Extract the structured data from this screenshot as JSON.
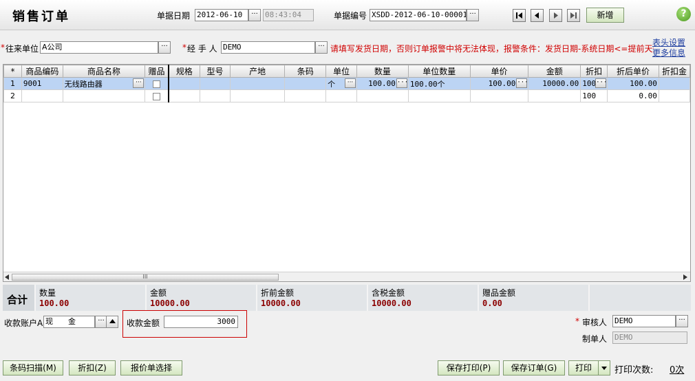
{
  "header": {
    "title": "销售订单",
    "date_label": "单据日期",
    "date_value": "2012-06-10",
    "time_value": "08:43:04",
    "docno_label": "单据编号",
    "docno_value": "XSDD-2012-06-10-00001",
    "new_button": "新增",
    "help": "?"
  },
  "party": {
    "req_mark": "*",
    "customer_label": "往来单位",
    "customer_value": "A公司",
    "handler_label": "经 手 人",
    "handler_value": "DEMO",
    "warning": "请填写发货日期，否则订单报警中将无法体现，报警条件：发货日期-系统日期<=提前天数",
    "header_settings_link": "表头设置",
    "more_info_link": "更多信息"
  },
  "grid": {
    "columns": [
      "*",
      "商品编码",
      "商品名称",
      "赠品",
      "规格",
      "型号",
      "产地",
      "条码",
      "单位",
      "数量",
      "单位数量",
      "单价",
      "金额",
      "折扣",
      "折后单价",
      "折扣金"
    ],
    "rows": [
      {
        "no": "1",
        "code": "9001",
        "name": "无线路由器",
        "spec": "",
        "model": "",
        "origin": "",
        "barcode": "",
        "unit": "个",
        "qty": "100.00",
        "unit_qty": "100.00个",
        "price": "100.00",
        "amount": "10000.00",
        "discount": "100",
        "disc_price": "100.00",
        "disc_amount": ""
      },
      {
        "no": "2",
        "code": "",
        "name": "",
        "spec": "",
        "model": "",
        "origin": "",
        "barcode": "",
        "unit": "",
        "qty": "",
        "unit_qty": "",
        "price": "",
        "amount": "",
        "discount": "100",
        "disc_price": "0.00",
        "disc_amount": ""
      }
    ],
    "scroll_grip": "III"
  },
  "summary": {
    "total_label": "合计",
    "items": [
      {
        "label": "数量",
        "value": "100.00"
      },
      {
        "label": "金额",
        "value": "10000.00"
      },
      {
        "label": "折前金额",
        "value": "10000.00"
      },
      {
        "label": "含税金额",
        "value": "10000.00"
      },
      {
        "label": "赠品金额",
        "value": "0.00"
      }
    ]
  },
  "payment": {
    "account_label": "收款账户A",
    "account_value": "现　　金",
    "amount_label": "收款金额",
    "amount_value": "3000",
    "auditor_req": "*",
    "auditor_label": "审核人",
    "auditor_value": "DEMO",
    "maker_label": "制单人",
    "maker_value": "DEMO"
  },
  "footer": {
    "barcode_scan": "条码扫描(M)",
    "discount": "折扣(Z)",
    "quote_select": "报价单选择",
    "save_print": "保存打印(P)",
    "save_order": "保存订单(G)",
    "print": "打印",
    "print_count_label": "打印次数:",
    "print_count_value": "0次"
  },
  "colors": {
    "accent_green": "#d4e6c0",
    "selected_row": "#bcd4f4",
    "warning_red": "#d00000",
    "total_red": "#8b0000"
  }
}
